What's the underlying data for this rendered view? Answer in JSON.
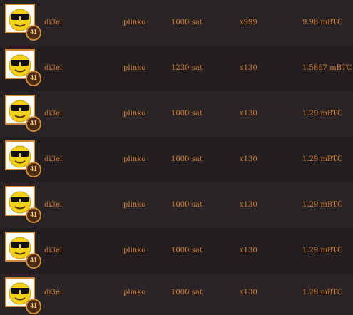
{
  "rows": [
    {
      "user": "di3el",
      "level": "41",
      "game": "plinko",
      "bet": "1000 sat",
      "multiplier": "x999",
      "profit": "9.98 mBTC"
    },
    {
      "user": "di3el",
      "level": "41",
      "game": "plinko",
      "bet": "1230 sat",
      "multiplier": "x130",
      "profit": "1.5867 mBTC"
    },
    {
      "user": "di3el",
      "level": "41",
      "game": "plinko",
      "bet": "1000 sat",
      "multiplier": "x130",
      "profit": "1.29 mBTC"
    },
    {
      "user": "di3el",
      "level": "41",
      "game": "plinko",
      "bet": "1000 sat",
      "multiplier": "x130",
      "profit": "1.29 mBTC"
    },
    {
      "user": "di3el",
      "level": "41",
      "game": "plinko",
      "bet": "1000 sat",
      "multiplier": "x130",
      "profit": "1.29 mBTC"
    },
    {
      "user": "di3el",
      "level": "41",
      "game": "plinko",
      "bet": "1000 sat",
      "multiplier": "x130",
      "profit": "1.29 mBTC"
    },
    {
      "user": "di3el",
      "level": "41",
      "game": "plinko",
      "bet": "1000 sat",
      "multiplier": "x130",
      "profit": "1.29 mBTC"
    }
  ],
  "colors": {
    "text": "#d07f2a",
    "row_odd": "#2b2427",
    "row_even": "#241e21",
    "frame": "#c98a3a"
  },
  "avatar_icon": "sunglasses-smiley-icon"
}
